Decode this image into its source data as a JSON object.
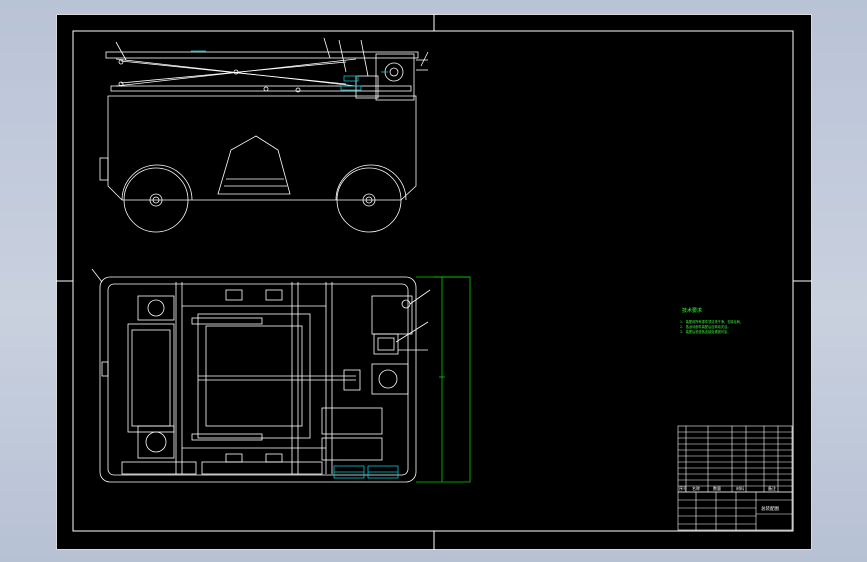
{
  "colors": {
    "background": "#000000",
    "line": "#ffffff",
    "dimension": "#00d000",
    "highlight": "#00c8d8",
    "note_text": "#3cff3c",
    "chrome": "#c3cbdc"
  },
  "drawing": {
    "views": [
      "side-view",
      "top-view"
    ],
    "notes_title": "技术要求",
    "notes_lines": [
      "1. 装配前所有零件须清洗干净，去除毛刺。",
      "2. 各运动部件装配后应转动灵活。",
      "3. 装配后检查各连接处紧固可靠。"
    ],
    "title_block": {
      "drawing_name": "总装配图",
      "labels": [
        "序号",
        "名称",
        "数量",
        "材料",
        "备注"
      ]
    }
  }
}
